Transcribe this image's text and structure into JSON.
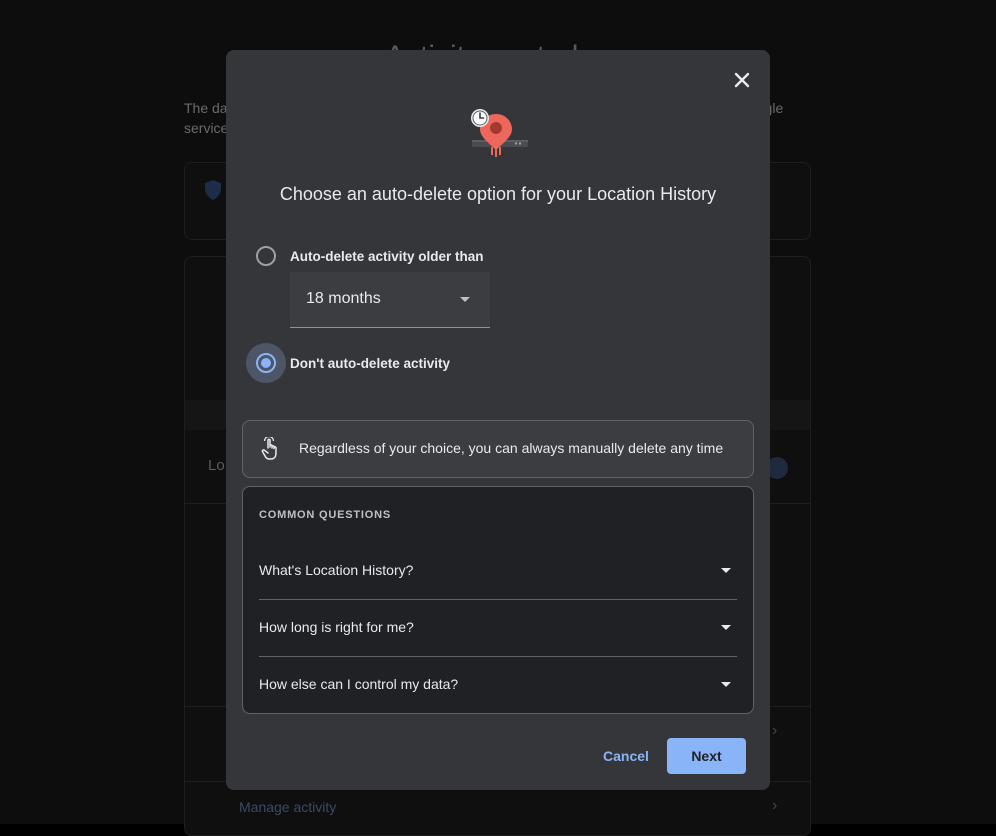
{
  "background": {
    "title": "Activity controls",
    "description": "The data saved in your account helps give you more personalized experiences across all Google services.",
    "row_label": "Lo",
    "manage_activity": "Manage activity"
  },
  "dialog": {
    "close_icon": "close-icon",
    "hero_icon": "location-history-timer-icon",
    "title": "Choose an auto-delete option for your Location History",
    "options": [
      {
        "label": "Auto-delete activity older than",
        "checked": false
      },
      {
        "label": "Don't auto-delete activity",
        "checked": true
      }
    ],
    "period_select": {
      "value": "18 months"
    },
    "notice": {
      "icon": "hand-pointer-icon",
      "text": "Regardless of your choice, you can always manually delete any time"
    },
    "faq": {
      "heading": "COMMON QUESTIONS",
      "questions": [
        "What's Location History?",
        "How long is right for me?",
        "How else can I control my data?"
      ]
    },
    "buttons": {
      "cancel": "Cancel",
      "next": "Next"
    }
  },
  "colors": {
    "accent": "#8ab4f8",
    "dialog_bg": "#35363a",
    "faq_bg": "#202124",
    "pin_red": "#ee675c"
  }
}
